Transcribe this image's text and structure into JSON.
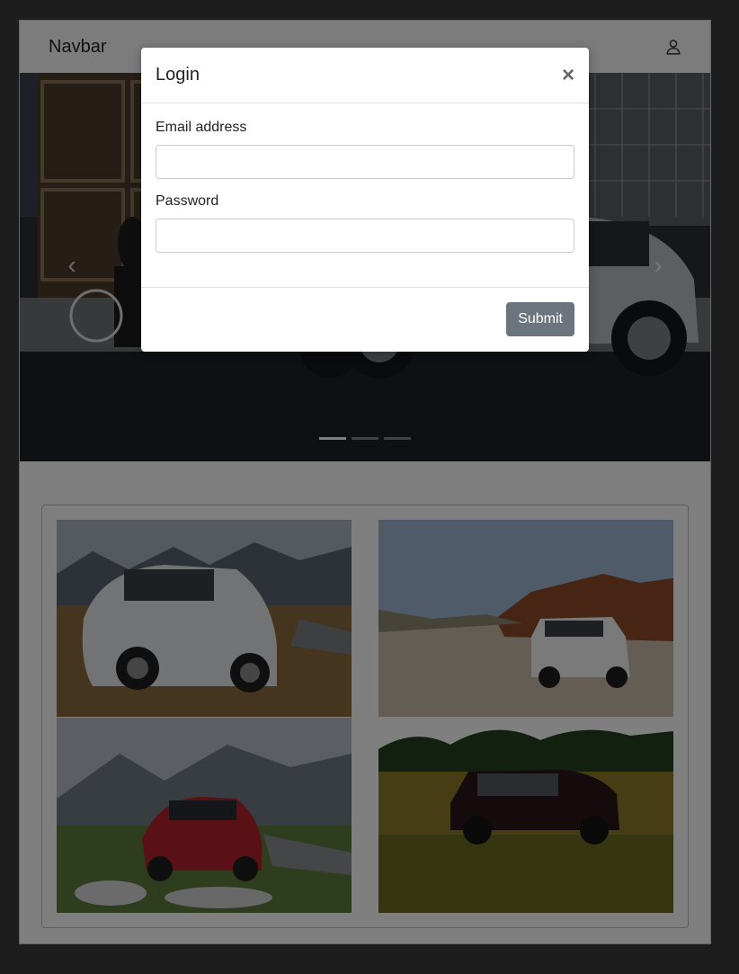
{
  "navbar": {
    "brand": "Navbar",
    "user_icon": "user-icon"
  },
  "carousel": {
    "slide_count": 3,
    "active_slide": 1,
    "prev_icon": "chevron-left-icon",
    "next_icon": "chevron-right-icon"
  },
  "gallery": {
    "photo_count": 4
  },
  "modal": {
    "title": "Login",
    "close_label": "×",
    "email_label": "Email address",
    "email_value": "",
    "password_label": "Password",
    "password_value": "",
    "submit_label": "Submit"
  },
  "colors": {
    "submit_button": "#6c757d",
    "backdrop": "#000000"
  }
}
